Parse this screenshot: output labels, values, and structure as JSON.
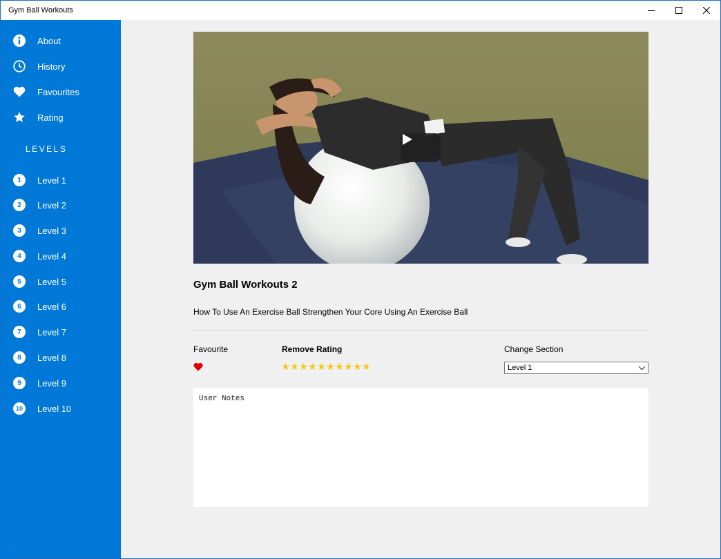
{
  "window": {
    "title": "Gym Ball Workouts"
  },
  "sidebar": {
    "items": [
      {
        "label": "About",
        "icon": "info-icon"
      },
      {
        "label": "History",
        "icon": "clock-icon"
      },
      {
        "label": "Favourites",
        "icon": "heart-icon"
      },
      {
        "label": "Rating",
        "icon": "star-icon"
      }
    ],
    "levels_heading": "LEVELS",
    "levels": [
      {
        "number": "1",
        "label": "Level 1"
      },
      {
        "number": "2",
        "label": "Level 2"
      },
      {
        "number": "3",
        "label": "Level 3"
      },
      {
        "number": "4",
        "label": "Level 4"
      },
      {
        "number": "5",
        "label": "Level 5"
      },
      {
        "number": "6",
        "label": "Level 6"
      },
      {
        "number": "7",
        "label": "Level 7"
      },
      {
        "number": "8",
        "label": "Level 8"
      },
      {
        "number": "9",
        "label": "Level 9"
      },
      {
        "number": "10",
        "label": "Level 10"
      }
    ]
  },
  "main": {
    "video": {
      "play_icon": "play-icon"
    },
    "title": "Gym Ball Workouts 2",
    "description": "How To Use An Exercise Ball Strengthen Your Core Using An Exercise Ball",
    "favourite": {
      "label": "Favourite",
      "is_favourite": true
    },
    "rating": {
      "label": "Remove Rating",
      "stars": 10,
      "max_stars": 10
    },
    "section": {
      "label": "Change Section",
      "selected": "Level 1"
    },
    "notes": {
      "placeholder": "User Notes"
    }
  },
  "colors": {
    "accent": "#0078d7",
    "star": "#f3c80f",
    "heart": "#e00000",
    "background": "#f0f0f0"
  }
}
